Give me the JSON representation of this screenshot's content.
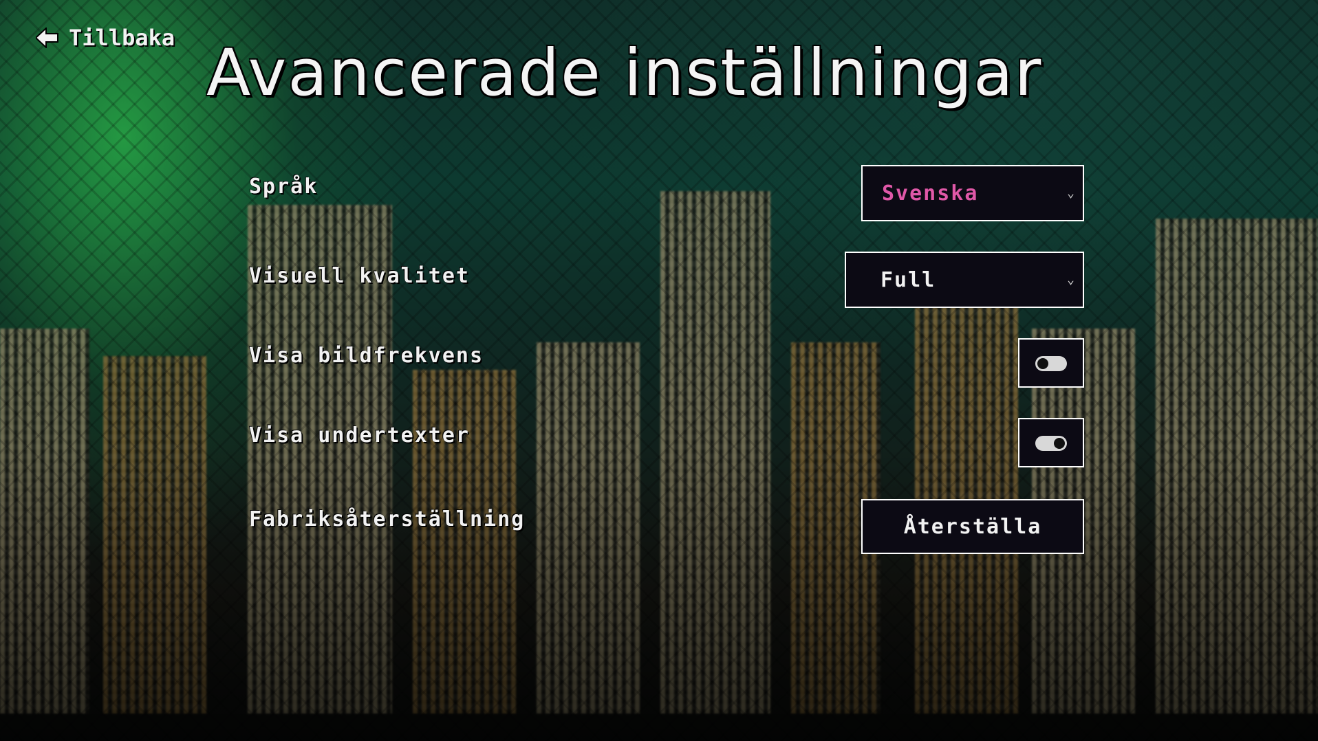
{
  "header": {
    "back_label": "Tillbaka",
    "back_icon": "arrow-left-icon",
    "title": "Avancerade inställningar"
  },
  "settings": {
    "language": {
      "label": "Språk",
      "value": "Svenska",
      "value_color": "#e058a8"
    },
    "visual_quality": {
      "label": "Visuell kvalitet",
      "value": "Full"
    },
    "show_framerate": {
      "label": "Visa bildfrekvens",
      "enabled": false
    },
    "show_subtitles": {
      "label": "Visa undertexter",
      "enabled": true
    },
    "factory_reset": {
      "label": "Fabriksåterställning",
      "button_label": "Återställa"
    }
  },
  "colors": {
    "accent_pink": "#e058a8",
    "panel_bg": "#0c0a14",
    "text": "#f2f2f2"
  }
}
